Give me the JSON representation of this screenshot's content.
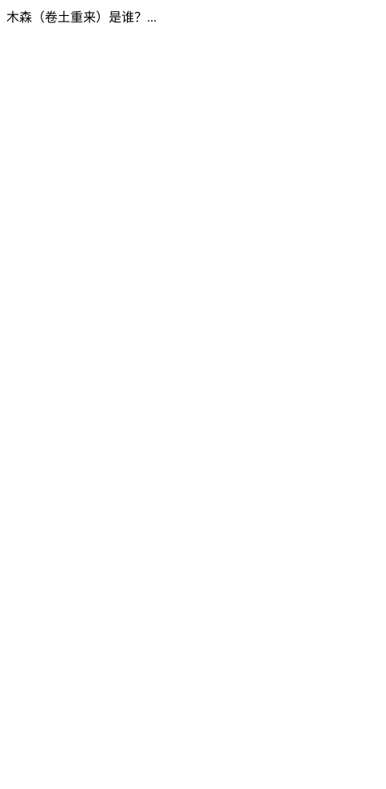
{
  "header": {
    "title": "木森（卷土重来）是谁？..."
  }
}
